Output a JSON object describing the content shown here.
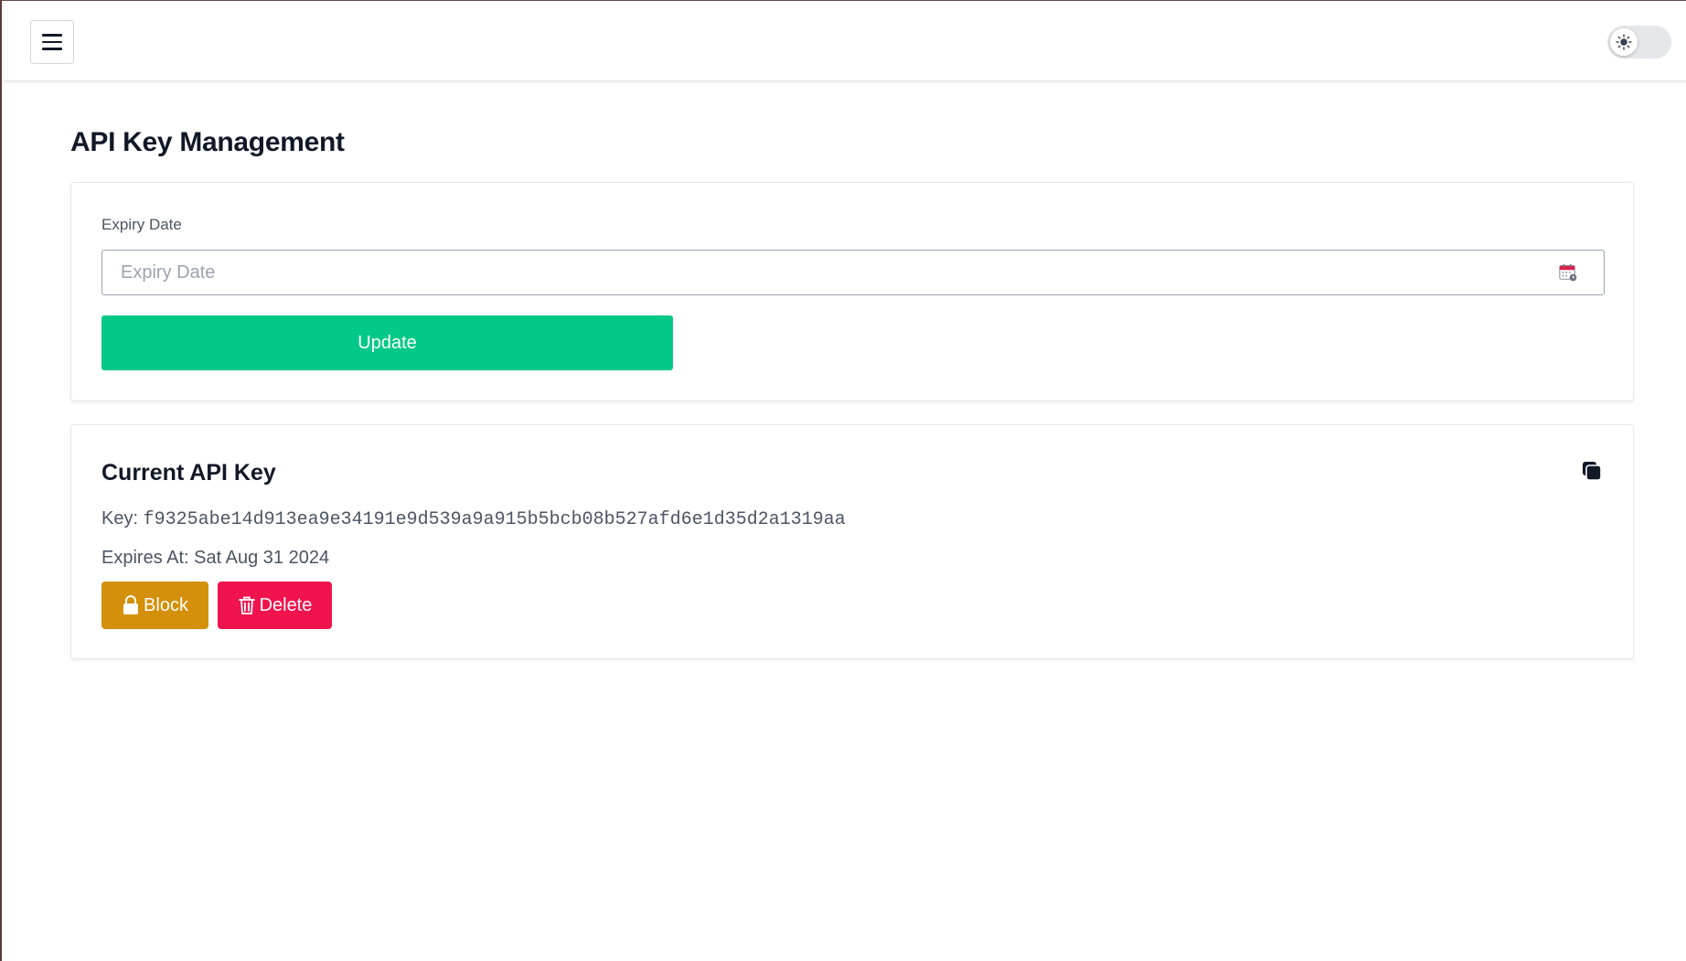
{
  "header": {
    "menu_icon": "hamburger-menu-icon",
    "theme_toggle_icon": "sun-icon",
    "theme_mode": "light"
  },
  "page": {
    "title": "API Key Management"
  },
  "expiry_form": {
    "label": "Expiry Date",
    "placeholder": "Expiry Date",
    "value": "",
    "calendar_icon": "calendar-icon",
    "update_label": "Update",
    "update_color": "#03c988"
  },
  "current_key": {
    "title": "Current API Key",
    "copy_icon": "copy-icon",
    "key_label": "Key:",
    "key_value": "f9325abe14d913ea9e34191e9d539a9a915b5bcb08b527afd6e1d35d2a1319aa",
    "expires_label": "Expires At:",
    "expires_value": "Sat Aug 31 2024",
    "block_label": "Block",
    "block_icon": "lock-icon",
    "block_color": "#d4900a",
    "delete_label": "Delete",
    "delete_icon": "trash-icon",
    "delete_color": "#f0134d"
  }
}
